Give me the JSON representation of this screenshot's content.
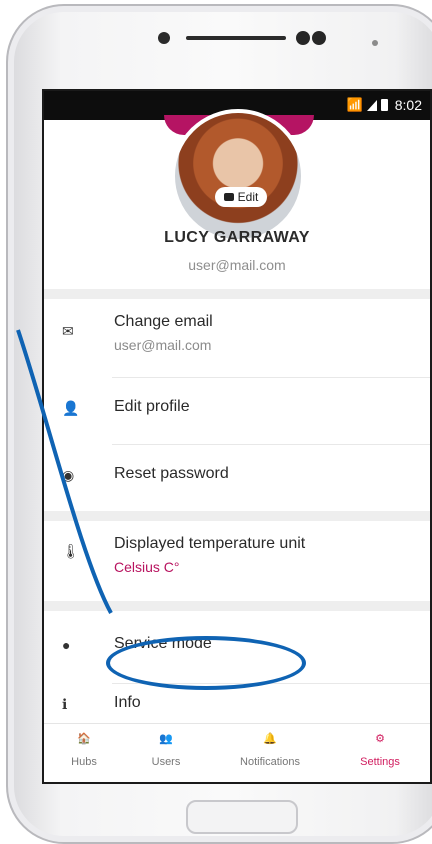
{
  "status": {
    "time": "8:02"
  },
  "profile": {
    "edit_label": "Edit",
    "name": "LUCY GARRAWAY",
    "email": "user@mail.com"
  },
  "settings": {
    "items": [
      {
        "title": "Change email",
        "subtitle": "user@mail.com"
      },
      {
        "title": "Edit profile"
      },
      {
        "title": "Reset password"
      },
      {
        "title": "Displayed temperature unit",
        "subtitle": "Celsius C°"
      },
      {
        "title": "Service mode"
      },
      {
        "title": "Info"
      }
    ]
  },
  "nav": {
    "items": [
      {
        "label": "Hubs"
      },
      {
        "label": "Users"
      },
      {
        "label": "Notifications"
      },
      {
        "label": "Settings"
      }
    ]
  },
  "colors": {
    "accent": "#d11d5f",
    "annotation": "#0f63b3"
  }
}
